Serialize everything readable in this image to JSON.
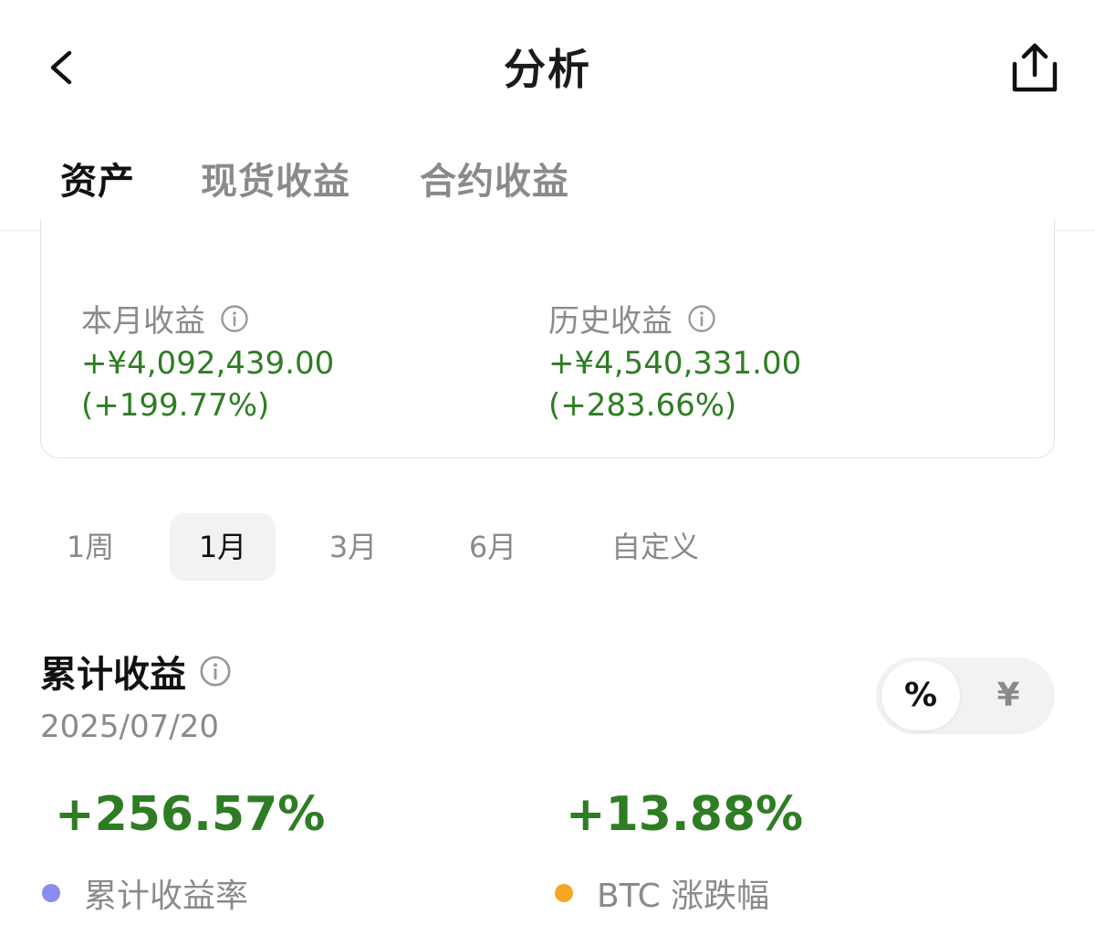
{
  "header": {
    "title": "分析"
  },
  "tabs": [
    {
      "label": "资产",
      "active": true
    },
    {
      "label": "现货收益",
      "active": false
    },
    {
      "label": "合约收益",
      "active": false
    }
  ],
  "summary": {
    "month": {
      "label": "本月收益",
      "amount": "+¥4,092,439.00",
      "pct": "(+199.77%)"
    },
    "history": {
      "label": "历史收益",
      "amount": "+¥4,540,331.00",
      "pct": "(+283.66%)"
    }
  },
  "ranges": [
    {
      "label": "1周",
      "active": false
    },
    {
      "label": "1月",
      "active": true
    },
    {
      "label": "3月",
      "active": false
    },
    {
      "label": "6月",
      "active": false
    },
    {
      "label": "自定义",
      "active": false
    }
  ],
  "cumulative": {
    "title": "累计收益",
    "date": "2025/07/20",
    "toggle": {
      "percent": "%",
      "yuan": "¥",
      "selected": "percent"
    },
    "metrics": [
      {
        "value": "+256.57%",
        "label": "累计收益率",
        "dot_color": "#8b8cf0"
      },
      {
        "value": "+13.88%",
        "label": "BTC 涨跌幅",
        "dot_color": "#f5a623"
      }
    ]
  },
  "colors": {
    "positive": "#2e7d24",
    "muted": "#8a8a8a",
    "text": "#111111"
  }
}
